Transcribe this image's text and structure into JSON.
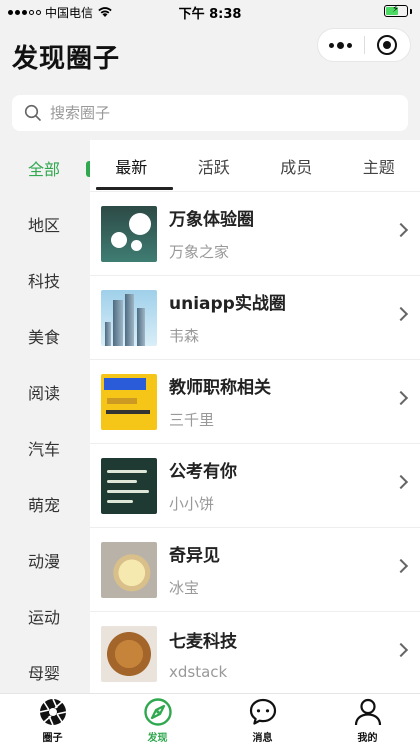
{
  "status_bar": {
    "carrier": "中国电信",
    "time": "下午 8:38"
  },
  "header": {
    "title": "发现圈子"
  },
  "search": {
    "placeholder": "搜索圈子"
  },
  "sidebar": {
    "items": [
      {
        "label": "全部",
        "active": true
      },
      {
        "label": "地区"
      },
      {
        "label": "科技"
      },
      {
        "label": "美食"
      },
      {
        "label": "阅读"
      },
      {
        "label": "汽车"
      },
      {
        "label": "萌宠"
      },
      {
        "label": "动漫"
      },
      {
        "label": "运动"
      },
      {
        "label": "母婴"
      }
    ]
  },
  "tabs": [
    {
      "label": "最新",
      "active": true
    },
    {
      "label": "活跃"
    },
    {
      "label": "成员"
    },
    {
      "label": "主题"
    }
  ],
  "circles": [
    {
      "name": "万象体验圈",
      "owner": "万象之家",
      "thumb": "t1"
    },
    {
      "name": "uniapp实战圈",
      "owner": "韦森",
      "thumb": "t2"
    },
    {
      "name": "教师职称相关",
      "owner": "三千里",
      "thumb": "t3"
    },
    {
      "name": "公考有你",
      "owner": "小小饼",
      "thumb": "t4"
    },
    {
      "name": "奇异见",
      "owner": "冰宝",
      "thumb": "t5"
    },
    {
      "name": "七麦科技",
      "owner": "xdstack",
      "thumb": "t6"
    }
  ],
  "tabbar": [
    {
      "label": "圈子",
      "icon": "aperture-icon"
    },
    {
      "label": "发现",
      "icon": "compass-icon",
      "active": true
    },
    {
      "label": "消息",
      "icon": "chat-bubble-icon"
    },
    {
      "label": "我的",
      "icon": "user-icon"
    }
  ],
  "colors": {
    "accent": "#2fa84f",
    "battery": "#4cd964"
  }
}
